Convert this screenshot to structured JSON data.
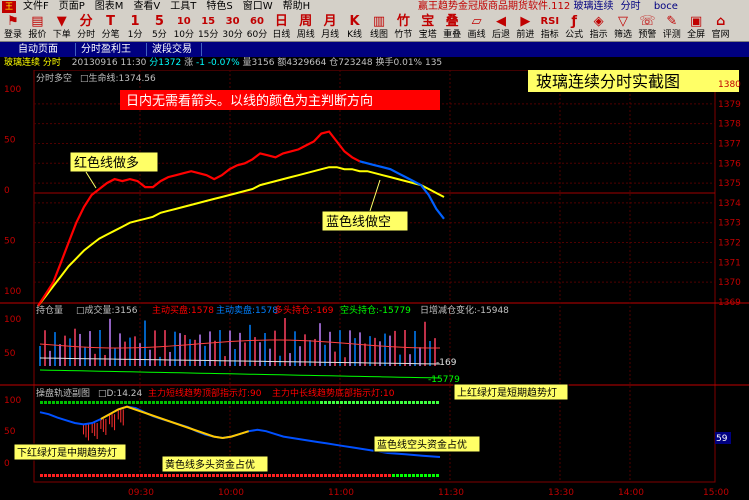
{
  "menu": [
    "文件F",
    "页面P",
    "图表M",
    "查看V",
    "工具T",
    "特色S",
    "窗口W",
    "帮助H"
  ],
  "app_title": "赢王趋势金冠版商品期货软件.112",
  "app_title_highlight": "玻璃连续",
  "app_title_mode": "分时",
  "app_title_user": "boce",
  "toolbar": {
    "left": [
      {
        "icon": "⚑",
        "label": "登录"
      },
      {
        "icon": "▤",
        "label": "报价"
      },
      {
        "icon": "▼",
        "label": "下单"
      }
    ],
    "periods": [
      {
        "icon": "分",
        "label": "分时"
      },
      {
        "icon": "T",
        "label": "分笔"
      },
      {
        "icon": "1",
        "label": "1分"
      },
      {
        "icon": "5",
        "label": "5分"
      },
      {
        "icon": "10",
        "label": "10分"
      },
      {
        "icon": "15",
        "label": "15分"
      },
      {
        "icon": "30",
        "label": "30分"
      },
      {
        "icon": "60",
        "label": "60分"
      },
      {
        "icon": "日",
        "label": "日线"
      },
      {
        "icon": "周",
        "label": "周线"
      },
      {
        "icon": "月",
        "label": "月线"
      },
      {
        "icon": "K",
        "label": "K线"
      }
    ],
    "right": [
      {
        "icon": "▥",
        "label": "线图"
      },
      {
        "icon": "竹",
        "label": "竹节"
      },
      {
        "icon": "宝",
        "label": "宝塔"
      },
      {
        "icon": "叠",
        "label": "重叠"
      },
      {
        "icon": "▱",
        "label": "画线"
      },
      {
        "icon": "◀",
        "label": "后退"
      },
      {
        "icon": "▶",
        "label": "前进"
      },
      {
        "icon": "RSI",
        "label": "指标"
      },
      {
        "icon": "ƒ",
        "label": "公式"
      },
      {
        "icon": "◈",
        "label": "指示"
      },
      {
        "icon": "▽",
        "label": "筛选"
      },
      {
        "icon": "☏",
        "label": "预警"
      },
      {
        "icon": "✎",
        "label": "评测"
      },
      {
        "icon": "▣",
        "label": "全屏"
      },
      {
        "icon": "⌂",
        "label": "官网"
      }
    ]
  },
  "tabs": [
    "自动页面",
    "分时盈利王",
    "波段交易"
  ],
  "info": {
    "symbol": "玻璃连续",
    "mode": "分时",
    "date": "20130916",
    "time": "11:30",
    "price": "分1372",
    "change_label": "涨",
    "change": "-1",
    "pct": "-0.07%",
    "vol": "量3156",
    "amount": "额4329664",
    "oi": "仓723248",
    "turnover": "换手0.01%",
    "last": "135"
  },
  "main": {
    "title": "分时多空",
    "lifeline": "□生命线:1374.56",
    "banner": "玻璃连续分时实截图",
    "note": "日内无需看箭头。以线的颜色为主判断方向",
    "red_label": "红色线做多",
    "blue_label": "蓝色线做空"
  },
  "pos": {
    "title": "持仓量",
    "vol": "□成交量:3156",
    "active_buy": "主动买盘:1578",
    "active_sell": "主动卖盘:1578",
    "long": "多头持仓:-169",
    "short": "空头持仓:-15779",
    "daily": "日增减仓变化:-15948",
    "val1": "-169",
    "val2": "-15779"
  },
  "ind": {
    "title": "操盘轨迹副图",
    "d": "□D:14.24",
    "short_light": "主力短线趋势顶部指示灯:90",
    "mid_light": "主力中长线趋势底部指示灯:10",
    "note_top": "上红绿灯是短期趋势灯",
    "note_mid": "下红绿灯是中期趋势灯",
    "yellow_label": "黄色线多头资金占优",
    "blue_label": "蓝色线空头资金占优",
    "side_value": "59"
  },
  "time_axis": [
    "09:30",
    "10:00",
    "11:00",
    "11:30",
    "13:30",
    "14:00",
    "15:00"
  ],
  "y_left_main": [
    100,
    50,
    0,
    50,
    100
  ],
  "y_right_main": [
    1380,
    1379,
    1378,
    1377,
    1376,
    1375,
    1374,
    1373,
    1372,
    1371,
    1370,
    1369
  ],
  "y_left_pos": [
    100,
    50
  ],
  "y_left_ind": [
    100,
    50,
    0
  ],
  "colors": {
    "bg": "#000000",
    "grid": "#800000",
    "price": "#ff0000",
    "price_down": "#0060ff",
    "avg": "#ffff00",
    "accent": "#ff0000",
    "highlight": "#ffff66"
  },
  "chart_data": [
    {
      "type": "line",
      "series": [
        {
          "values": [
            1368.8,
            1369.4,
            1370,
            1371,
            1372,
            1373,
            1373.8,
            1374.4,
            1374.7,
            1375,
            1375.2,
            1375.1,
            1375.2,
            1375.1,
            1374.8,
            1374.8,
            1375.1,
            1375.3,
            1375.4,
            1375.5,
            1375.6,
            1375.5,
            1375.4,
            1375.2,
            1375.4,
            1375.7,
            1375.9,
            1376,
            1376.2,
            1376.5,
            1376.4,
            1376.3,
            1376.5,
            1376.6,
            1376.7,
            1376.9,
            1377.1,
            1377.5,
            1377.6,
            1377.1,
            1376.6,
            1376.3,
            1376.1,
            1376,
            1375.9,
            1375.8,
            1375.7,
            1375.5,
            1375.3,
            1375.1,
            1374.9,
            1374.4,
            1373.7,
            1373.2
          ]
        },
        {
          "values": [
            1368.8,
            1369.3,
            1369.8,
            1370.3,
            1370.8,
            1371.2,
            1371.6,
            1371.9,
            1372.2,
            1372.4,
            1372.6,
            1372.8,
            1373,
            1373.1,
            1373.2,
            1373.3,
            1373.5,
            1373.6,
            1373.7,
            1373.8,
            1373.9,
            1374,
            1374.1,
            1374.2,
            1374.3,
            1374.4,
            1374.5,
            1374.6,
            1374.7,
            1374.9,
            1375,
            1375.1,
            1375.2,
            1375.3,
            1375.4,
            1375.5,
            1375.6,
            1375.7,
            1375.8,
            1375.8,
            1375.7,
            1375.7,
            1375.6,
            1375.6,
            1375.5,
            1375.4,
            1375.3,
            1375.2,
            1375.1,
            1375,
            1374.9,
            1374.7,
            1374.5,
            1374.3
          ]
        }
      ]
    },
    {
      "type": "line",
      "series": [
        {
          "values": [
            88,
            85,
            80,
            76,
            72,
            70,
            72,
            78,
            85,
            92,
            96,
            94,
            88,
            82,
            78,
            74,
            70,
            66,
            60,
            55,
            52,
            50,
            52,
            56,
            60,
            62,
            60,
            56,
            52,
            50,
            48,
            46,
            44,
            42,
            40,
            38,
            36,
            34,
            32,
            30,
            28,
            27,
            26,
            25,
            24,
            23,
            22
          ]
        }
      ]
    }
  ]
}
